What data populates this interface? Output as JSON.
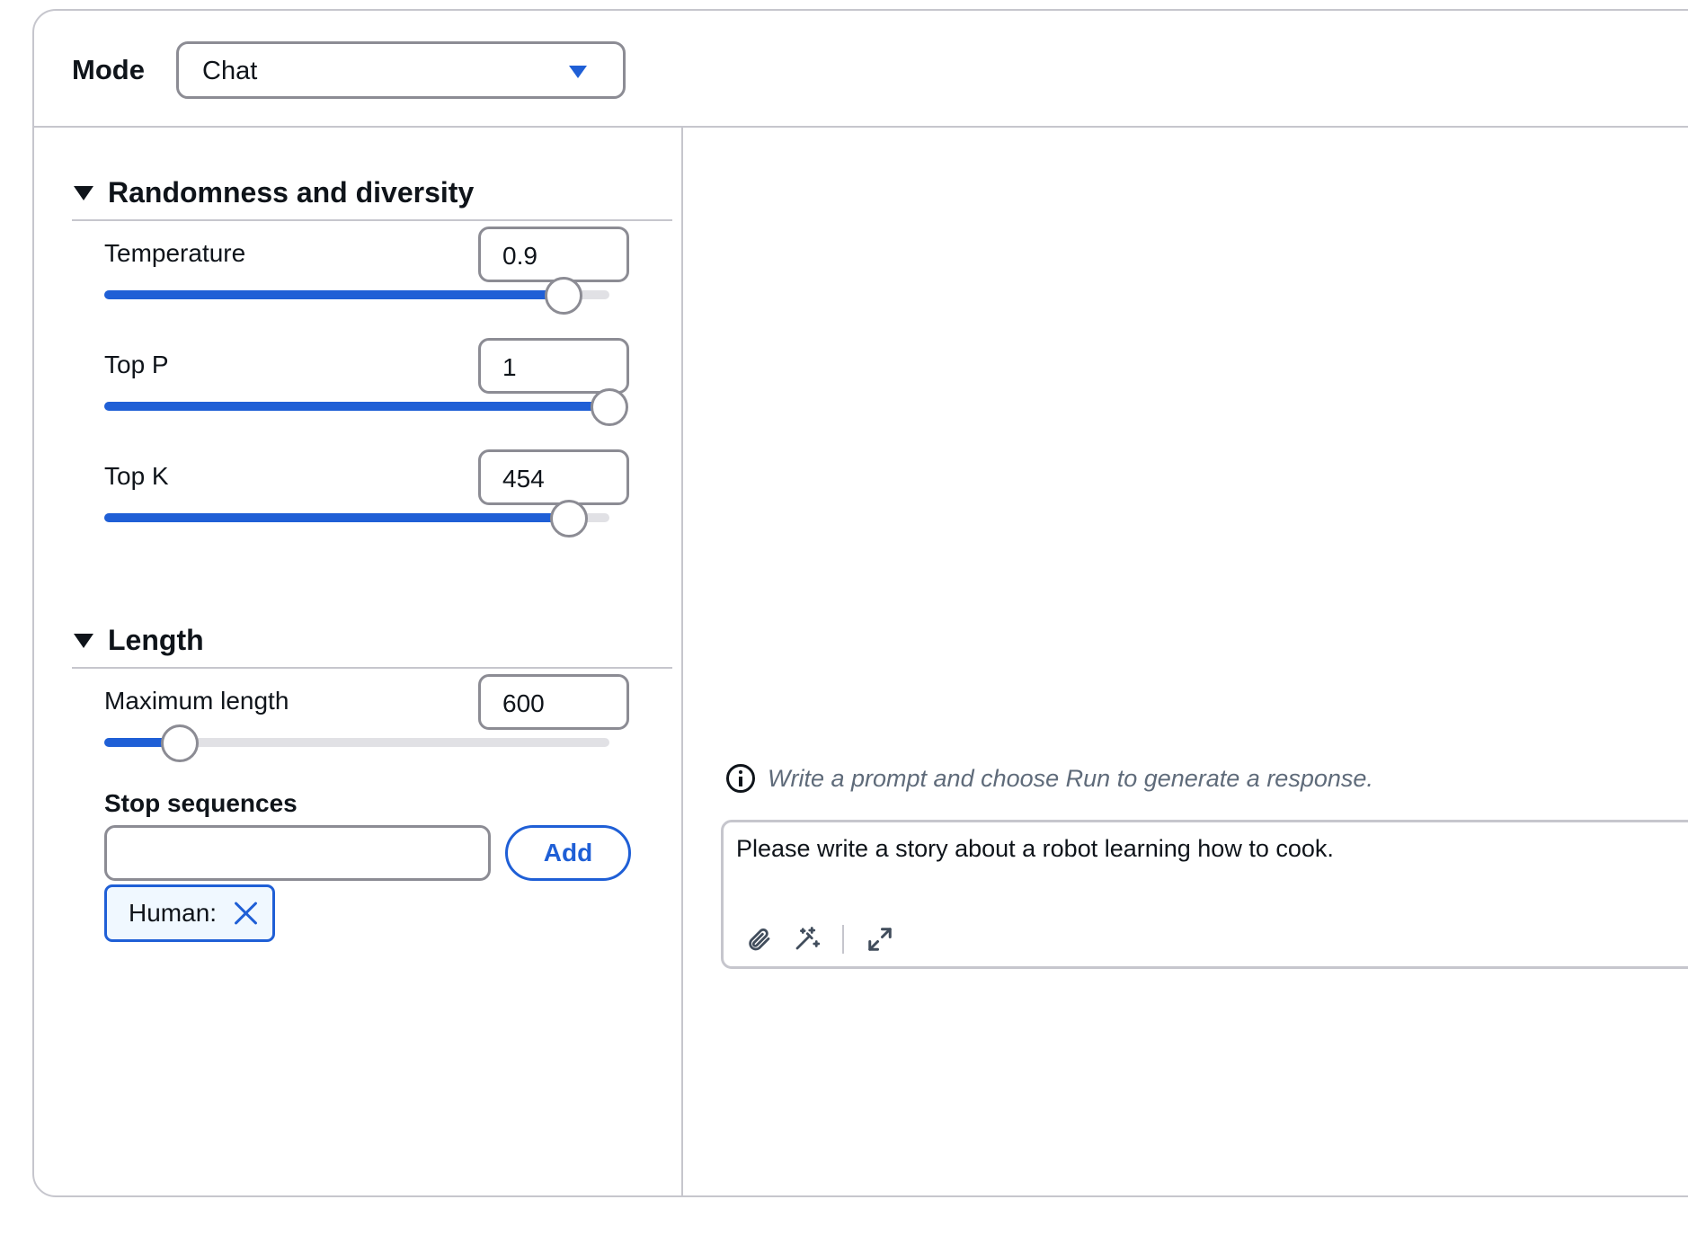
{
  "mode": {
    "label": "Mode",
    "selected": "Chat"
  },
  "sections": {
    "randomness": {
      "title": "Randomness and diversity",
      "params": [
        {
          "label": "Temperature",
          "value": "0.9",
          "fraction": 0.91
        },
        {
          "label": "Top P",
          "value": "1",
          "fraction": 1.0
        },
        {
          "label": "Top K",
          "value": "454",
          "fraction": 0.92
        }
      ]
    },
    "length": {
      "title": "Length",
      "max_length": {
        "label": "Maximum length",
        "value": "600",
        "fraction": 0.15
      },
      "stop": {
        "label": "Stop sequences",
        "input_value": "",
        "add_label": "Add",
        "tokens": [
          "Human:"
        ]
      }
    }
  },
  "chat": {
    "hint": "Write a prompt and choose Run to generate a response.",
    "prompt": "Please write a story about a robot learning how to cook.",
    "icons": [
      "paperclip-icon",
      "magic-wand-icon",
      "expand-icon"
    ]
  },
  "colors": {
    "accent": "#1f5fd6",
    "border": "#c6c6cd",
    "token_bg": "#f0f8ff"
  }
}
